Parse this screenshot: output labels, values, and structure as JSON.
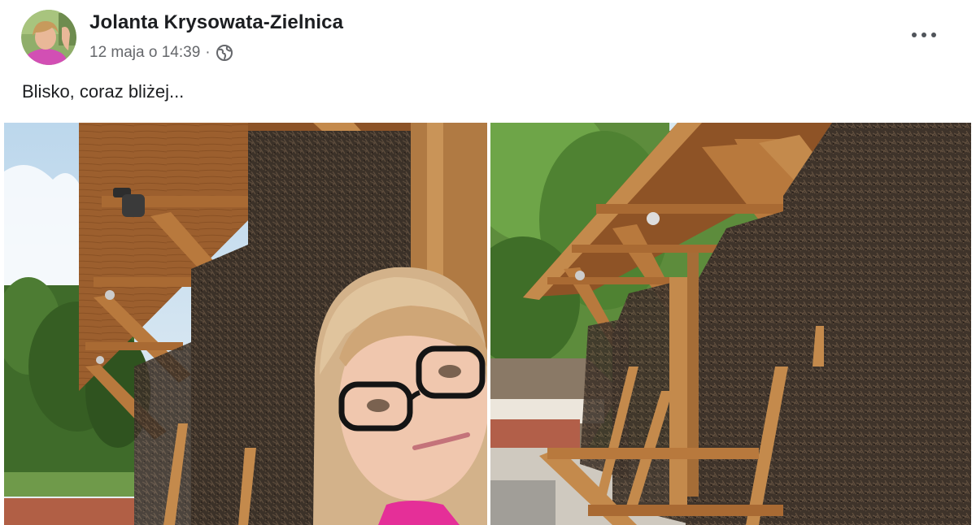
{
  "post": {
    "author_name": "Jolanta Krysowata-Zielnica",
    "timestamp": "12 maja o 14:39",
    "separator": "·",
    "audience_icon": "globe-icon",
    "more_icon": "ellipsis-icon",
    "text": "Blisko, coraz bliżej..."
  },
  "photos": [
    {
      "subject": "selfie in front of graduation tower"
    },
    {
      "subject": "graduation tower wooden structure"
    }
  ],
  "colors": {
    "name": "#1c1e21",
    "meta": "#65676b",
    "background": "#ffffff"
  }
}
